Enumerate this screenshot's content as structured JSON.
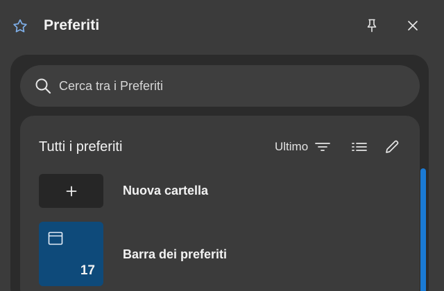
{
  "header": {
    "title": "Preferiti",
    "star_icon": "star-outline-icon",
    "pin_icon": "pin-icon",
    "close_icon": "close-icon"
  },
  "search": {
    "placeholder": "Cerca tra i Preferiti",
    "value": ""
  },
  "favorites": {
    "title": "Tutti i preferiti",
    "sort_label": "Ultimo",
    "items": [
      {
        "label": "Nuova cartella",
        "icon": "plus-icon"
      },
      {
        "label": "Barra dei preferiti",
        "icon": "window-icon",
        "count": "17"
      }
    ]
  },
  "colors": {
    "accent": "#1a7ad4",
    "folder_tile": "#0e4a7a",
    "background": "#3b3b3b"
  }
}
